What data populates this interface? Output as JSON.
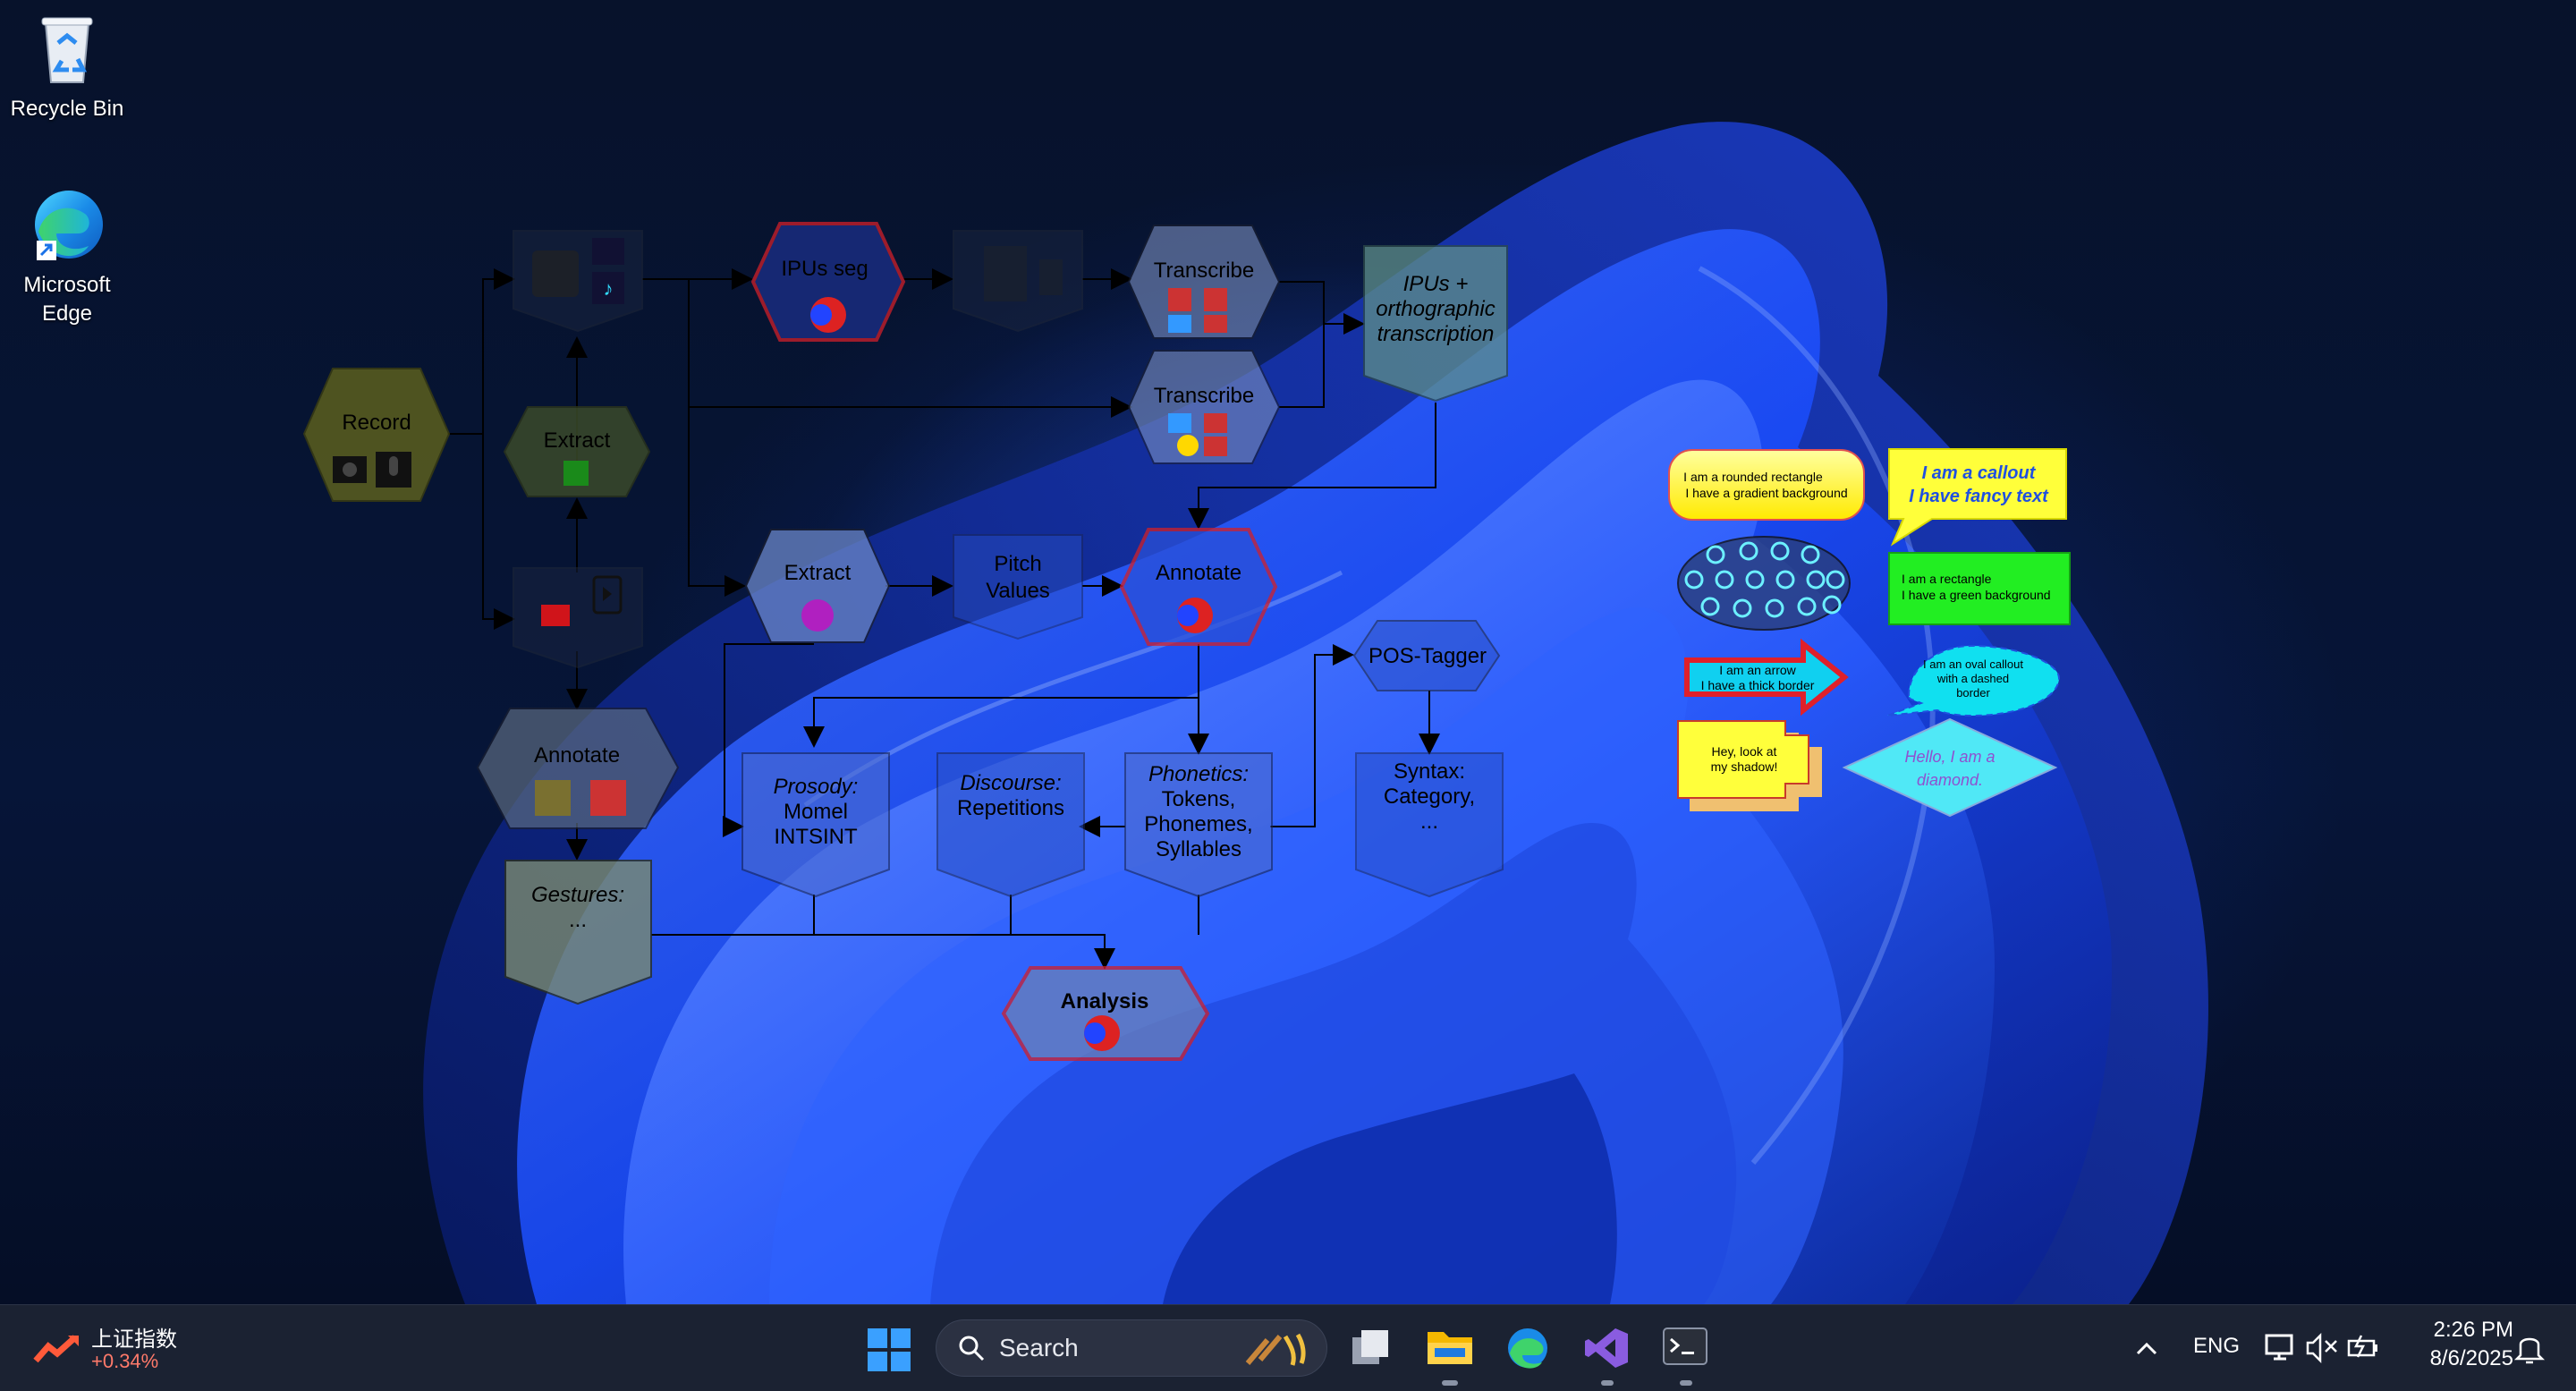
{
  "desktop": {
    "icons": [
      {
        "label": "Recycle Bin",
        "icon": "recycle-bin-icon"
      },
      {
        "label": "Microsoft Edge",
        "label_line1": "Microsoft",
        "label_line2": "Edge",
        "icon": "edge-icon"
      }
    ]
  },
  "diagram": {
    "nodes": {
      "record": "Record",
      "extract_small": "Extract",
      "ipus_seg": "IPUs seg",
      "transcribe1": "Transcribe",
      "transcribe2": "Transcribe",
      "ipus_ortho_line1": "IPUs +",
      "ipus_ortho_line2": "orthographic",
      "ipus_ortho_line3": "transcription",
      "extract_main": "Extract",
      "pitch_line1": "Pitch",
      "pitch_line2": "Values",
      "annotate_red": "Annotate",
      "pos_tagger": "POS-Tagger",
      "annotate_left": "Annotate",
      "prosody_line1": "Prosody:",
      "prosody_line2": "Momel",
      "prosody_line3": "INTSINT",
      "discourse_line1": "Discourse:",
      "discourse_line2": "Repetitions",
      "phonetics_line1": "Phonetics:",
      "phonetics_line2": "Tokens,",
      "phonetics_line3": "Phonemes,",
      "phonetics_line4": "Syllables",
      "syntax_line1": "Syntax:",
      "syntax_line2": "Category,",
      "syntax_line3": "...",
      "gestures_line1": "Gestures:",
      "gestures_line2": "...",
      "analysis": "Analysis"
    },
    "shapes": {
      "rounded_line1": "I am a rounded rectangle",
      "rounded_line2": "I have a gradient background",
      "callout_line1": "I am a callout",
      "callout_line2": "I have fancy text",
      "green_line1": "I am a rectangle",
      "green_line2": "I have a green background",
      "arrow_line1": "I am an arrow",
      "arrow_line2": "I have a thick border",
      "oval_line1": "I am an oval callout",
      "oval_line2": "with a dashed",
      "oval_line3": "border",
      "shadow_line1": "Hey, look at",
      "shadow_line2": "my shadow!",
      "diamond_line1": "Hello, I am a",
      "diamond_line2": "diamond."
    },
    "colors": {
      "olive": "#5b5f1e",
      "red_border": "#d0202a",
      "yellow": "#ffff3a",
      "green": "#22ee22",
      "cyan": "#10e0f0"
    }
  },
  "taskbar": {
    "stock_name": "上证指数",
    "stock_change": "+0.34%",
    "search_placeholder": "Search",
    "language": "ENG",
    "time": "2:26 PM",
    "date": "8/6/2025"
  }
}
